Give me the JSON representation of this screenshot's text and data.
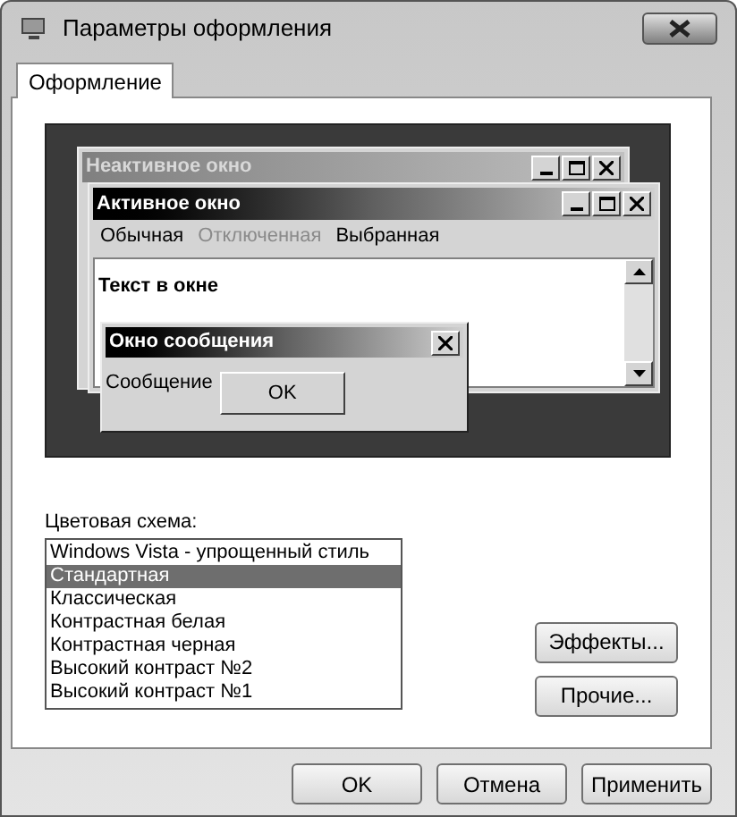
{
  "window": {
    "title": "Параметры оформления"
  },
  "tabs": [
    {
      "label": "Оформление",
      "selected": true
    }
  ],
  "preview": {
    "inactive_window": {
      "title": "Неактивное окно"
    },
    "active_window": {
      "title": "Активное окно",
      "menu": [
        {
          "label": "Обычная",
          "kind": "normal"
        },
        {
          "label": "Отключенная",
          "kind": "disabled"
        },
        {
          "label": "Выбранная",
          "kind": "selected"
        }
      ],
      "text": "Текст в окне"
    },
    "message_box": {
      "title": "Окно сообщения",
      "message": "Сообщение",
      "button": "OK"
    }
  },
  "color_scheme": {
    "label": "Цветовая схема:",
    "items": [
      {
        "label": "Windows Vista - упрощенный стиль",
        "selected": false
      },
      {
        "label": "Стандартная",
        "selected": true
      },
      {
        "label": "Классическая",
        "selected": false
      },
      {
        "label": "Контрастная белая",
        "selected": false
      },
      {
        "label": "Контрастная черная",
        "selected": false
      },
      {
        "label": "Высокий контраст №2",
        "selected": false
      },
      {
        "label": "Высокий контраст №1",
        "selected": false
      }
    ]
  },
  "side_buttons": [
    "Эффекты...",
    "Прочие..."
  ],
  "buttons": [
    "OK",
    "Отмена",
    "Применить"
  ]
}
